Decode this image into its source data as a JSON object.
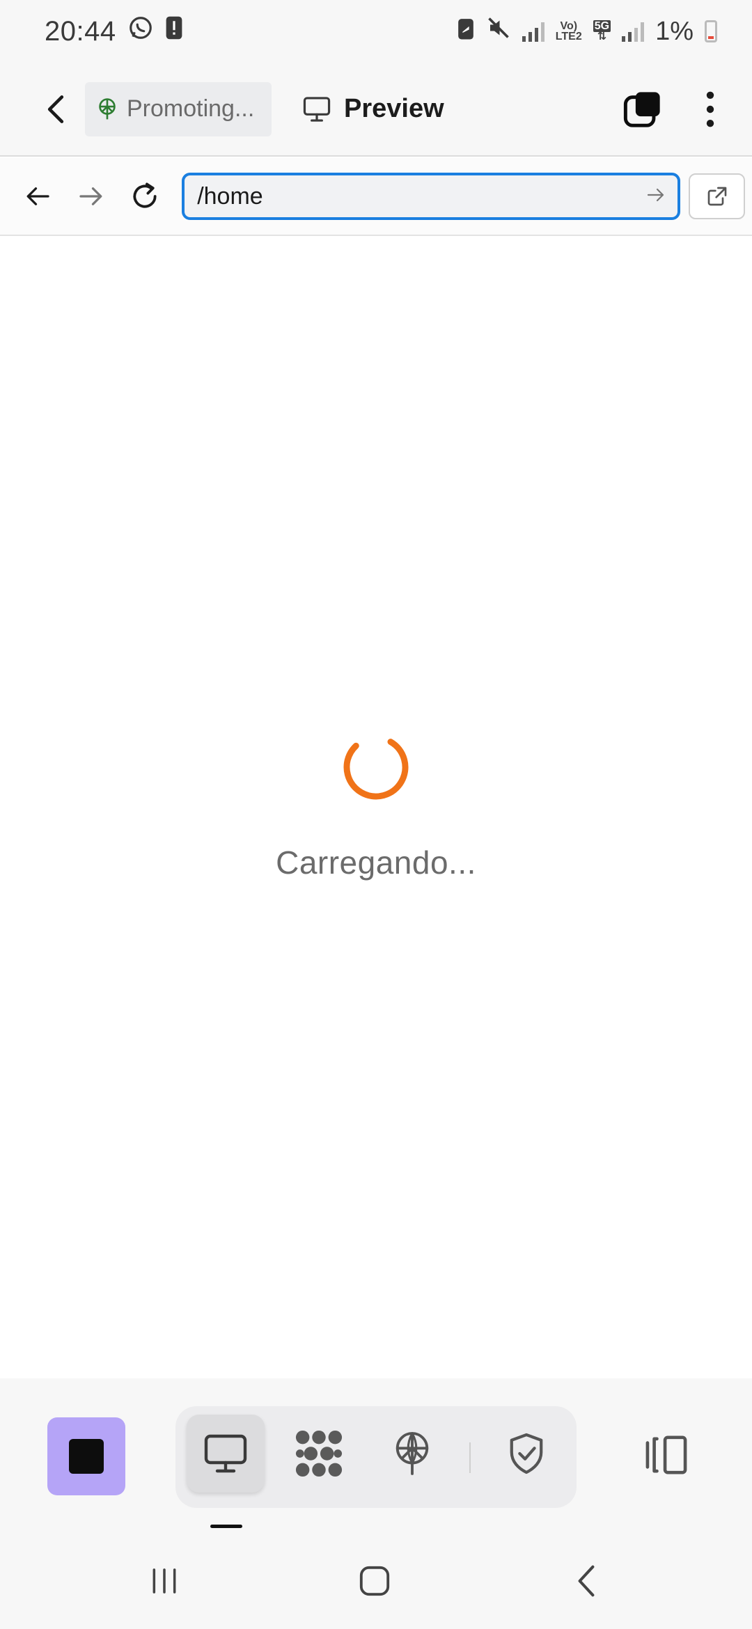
{
  "status_bar": {
    "time": "20:44",
    "network_top": "Vo)",
    "network_bottom": "LTE2",
    "five_g": "5G",
    "battery": "1%"
  },
  "header": {
    "project_name": "Promoting...",
    "tab_label": "Preview"
  },
  "browser": {
    "url": "/home"
  },
  "content": {
    "loading_text": "Carregando..."
  },
  "colors": {
    "spinner": "#f07318",
    "url_border": "#1a7fe0",
    "stop_button_bg": "#b5a4f7"
  },
  "toolbar": {
    "icons": [
      "stop-icon",
      "desktop-icon",
      "dots-pattern-icon",
      "deploy-icon",
      "shield-check-icon",
      "layout-toggle-icon"
    ]
  }
}
